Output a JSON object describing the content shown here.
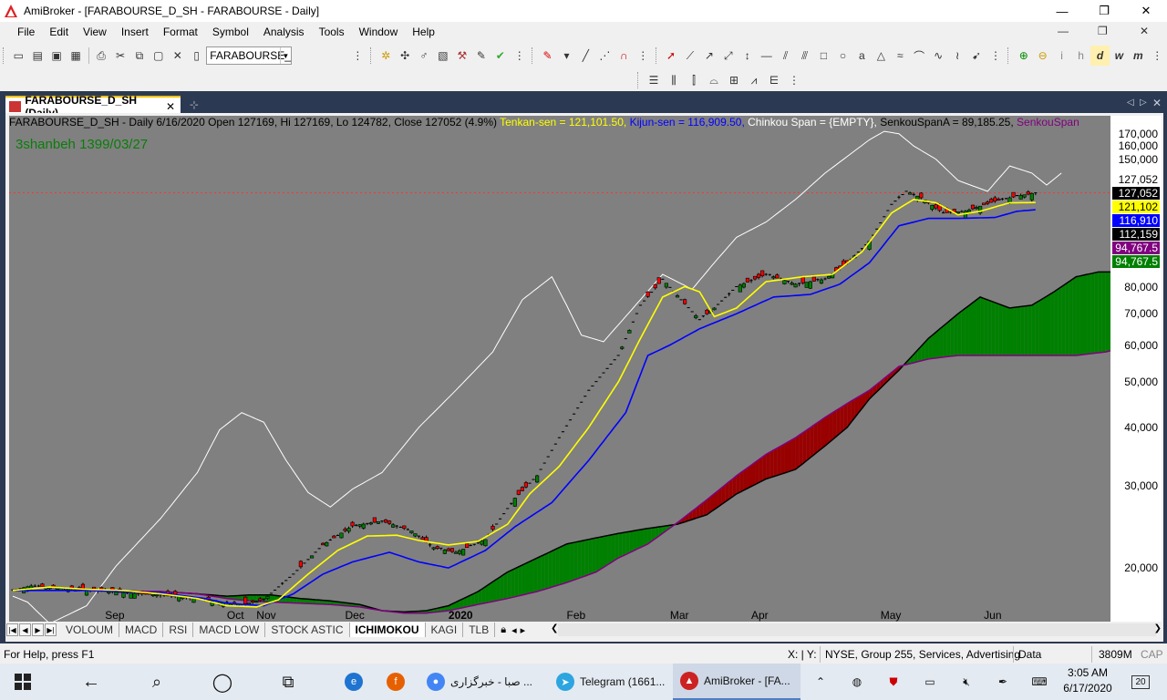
{
  "window": {
    "title": "AmiBroker - [FARABOURSE_D_SH - FARABOURSE - Daily]",
    "minimize": "—",
    "restore": "❐",
    "close": "✕"
  },
  "menu": [
    "File",
    "Edit",
    "View",
    "Insert",
    "Format",
    "Symbol",
    "Analysis",
    "Tools",
    "Window",
    "Help"
  ],
  "mdi": {
    "min": "—",
    "restore": "❐",
    "close": "✕"
  },
  "toolbar": {
    "symbol_value": "FARABOURSE_"
  },
  "doc_tab": {
    "label": "FARABOURSE_D_SH (Daily)",
    "close": "✕"
  },
  "chart_header": {
    "prefix": "FARABOURSE_D_SH - Daily 6/16/2020 Open 127169, Hi 127169, Lo 124782, Close 127052 (4.9%) ",
    "tenkan": "Tenkan-sen = 121,101.50, ",
    "kijun": "Kijun-sen = 116,909.50, ",
    "chinkou": "Chinkou Span = {EMPTY}, ",
    "senkou_a": "SenkouSpanA = 89,185.25, ",
    "senkou_b": "SenkouSpan"
  },
  "date_label": "3shanbeh 1399/03/27",
  "colors": {
    "background": "#808080",
    "tenkan": "#ffff00",
    "kijun": "#0000ff",
    "chinkou": "#ffffff",
    "cloud_bull": "#008000",
    "cloud_bear": "#990000",
    "senkou_a": "#000000",
    "senkou_b": "#800080",
    "candle_up": "#008000",
    "candle_down": "#ff0000"
  },
  "chart_data": {
    "type": "candlestick",
    "y_scale": "log",
    "ylim": [
      16200,
      176000
    ],
    "y_ticks": [
      "170,000",
      "160,000",
      "150,000",
      "80,000",
      "70,000",
      "60,000",
      "50,000",
      "40,000",
      "30,000",
      "20,000"
    ],
    "y_tick_values": [
      170000,
      160000,
      150000,
      80000,
      70000,
      60000,
      50000,
      40000,
      30000,
      20000
    ],
    "x_labels": [
      {
        "label": "Sep",
        "i": 25
      },
      {
        "label": "Oct",
        "i": 58
      },
      {
        "label": "Nov",
        "i": 66
      },
      {
        "label": "Dec",
        "i": 90
      },
      {
        "label": "2020",
        "i": 118
      },
      {
        "label": "Feb",
        "i": 150
      },
      {
        "label": "Mar",
        "i": 178
      },
      {
        "label": "Apr",
        "i": 200
      },
      {
        "label": "May",
        "i": 235
      },
      {
        "label": "Jun",
        "i": 263
      }
    ],
    "n_bars": 278,
    "last_close": 127052,
    "price_badges": [
      {
        "text": "127,052",
        "value": 127052,
        "bg": "#ffffff",
        "fg": "#000000"
      },
      {
        "text": "127,052",
        "value": 127052,
        "bg": "#000000",
        "fg": "#ffffff"
      },
      {
        "text": "121,102",
        "value": 121102,
        "bg": "#ffff00",
        "fg": "#000000"
      },
      {
        "text": "116,910",
        "value": 116910,
        "bg": "#0000ff",
        "fg": "#ffffff"
      },
      {
        "text": "112,159",
        "value": 112159,
        "bg": "#000000",
        "fg": "#ffffff"
      },
      {
        "text": "94,767.5",
        "value": 94767.5,
        "bg": "#800080",
        "fg": "#ffffff"
      },
      {
        "text": "94,767.5",
        "value": 94767.5,
        "bg": "#008000",
        "fg": "#ffffff"
      }
    ],
    "close_anchors": [
      [
        0,
        17900
      ],
      [
        5,
        18300
      ],
      [
        12,
        18100
      ],
      [
        22,
        17900
      ],
      [
        30,
        17700
      ],
      [
        40,
        17500
      ],
      [
        50,
        17200
      ],
      [
        56,
        16900
      ],
      [
        62,
        16700
      ],
      [
        68,
        17100
      ],
      [
        76,
        19400
      ],
      [
        84,
        22400
      ],
      [
        92,
        24600
      ],
      [
        100,
        25200
      ],
      [
        108,
        24000
      ],
      [
        114,
        22100
      ],
      [
        120,
        21600
      ],
      [
        128,
        23000
      ],
      [
        136,
        28200
      ],
      [
        142,
        31500
      ],
      [
        148,
        38000
      ],
      [
        156,
        48000
      ],
      [
        164,
        57000
      ],
      [
        170,
        73000
      ],
      [
        176,
        83000
      ],
      [
        181,
        75000
      ],
      [
        186,
        68000
      ],
      [
        190,
        72000
      ],
      [
        196,
        80000
      ],
      [
        204,
        85000
      ],
      [
        212,
        81000
      ],
      [
        220,
        83000
      ],
      [
        226,
        90000
      ],
      [
        232,
        100000
      ],
      [
        238,
        120000
      ],
      [
        242,
        128000
      ],
      [
        246,
        124000
      ],
      [
        252,
        115000
      ],
      [
        258,
        116000
      ],
      [
        266,
        122000
      ],
      [
        272,
        125000
      ],
      [
        277,
        127052
      ]
    ],
    "tenkan_anchors": [
      [
        0,
        17900
      ],
      [
        10,
        18200
      ],
      [
        20,
        18000
      ],
      [
        30,
        17900
      ],
      [
        40,
        17600
      ],
      [
        50,
        17200
      ],
      [
        54,
        16900
      ],
      [
        58,
        16600
      ],
      [
        66,
        16500
      ],
      [
        72,
        17100
      ],
      [
        80,
        19400
      ],
      [
        88,
        21800
      ],
      [
        96,
        23400
      ],
      [
        104,
        23500
      ],
      [
        110,
        22900
      ],
      [
        118,
        22400
      ],
      [
        126,
        22800
      ],
      [
        134,
        24800
      ],
      [
        140,
        28800
      ],
      [
        148,
        33000
      ],
      [
        156,
        40000
      ],
      [
        164,
        50000
      ],
      [
        170,
        62000
      ],
      [
        176,
        76000
      ],
      [
        182,
        80000
      ],
      [
        186,
        78000
      ],
      [
        190,
        69000
      ],
      [
        196,
        72000
      ],
      [
        204,
        82000
      ],
      [
        214,
        84000
      ],
      [
        222,
        85000
      ],
      [
        230,
        95000
      ],
      [
        238,
        115000
      ],
      [
        244,
        123000
      ],
      [
        250,
        121000
      ],
      [
        256,
        114000
      ],
      [
        262,
        116000
      ],
      [
        270,
        121000
      ],
      [
        277,
        121102
      ]
    ],
    "kijun_anchors": [
      [
        0,
        17900
      ],
      [
        20,
        17900
      ],
      [
        40,
        17700
      ],
      [
        52,
        17200
      ],
      [
        58,
        16800
      ],
      [
        68,
        16600
      ],
      [
        76,
        17600
      ],
      [
        84,
        19400
      ],
      [
        92,
        20600
      ],
      [
        102,
        21600
      ],
      [
        110,
        20600
      ],
      [
        118,
        20000
      ],
      [
        128,
        21800
      ],
      [
        136,
        24500
      ],
      [
        146,
        27600
      ],
      [
        156,
        34000
      ],
      [
        166,
        43000
      ],
      [
        172,
        57000
      ],
      [
        178,
        60000
      ],
      [
        186,
        65000
      ],
      [
        196,
        70000
      ],
      [
        206,
        76000
      ],
      [
        216,
        77000
      ],
      [
        224,
        81000
      ],
      [
        232,
        90000
      ],
      [
        240,
        108000
      ],
      [
        248,
        112000
      ],
      [
        256,
        112000
      ],
      [
        266,
        112500
      ],
      [
        272,
        116000
      ],
      [
        277,
        116910
      ]
    ],
    "chinkou_anchors": [
      [
        0,
        17400
      ],
      [
        4,
        16900
      ],
      [
        10,
        15200
      ],
      [
        20,
        16600
      ],
      [
        28,
        20200
      ],
      [
        40,
        25500
      ],
      [
        50,
        32000
      ],
      [
        56,
        39500
      ],
      [
        62,
        43000
      ],
      [
        68,
        41000
      ],
      [
        74,
        34000
      ],
      [
        80,
        29000
      ],
      [
        86,
        27000
      ],
      [
        92,
        29500
      ],
      [
        100,
        32000
      ],
      [
        110,
        40000
      ],
      [
        120,
        48000
      ],
      [
        130,
        58000
      ],
      [
        138,
        75000
      ],
      [
        146,
        84000
      ],
      [
        150,
        73000
      ],
      [
        154,
        63000
      ],
      [
        160,
        61000
      ],
      [
        168,
        72000
      ],
      [
        176,
        85000
      ],
      [
        184,
        79000
      ],
      [
        190,
        90000
      ],
      [
        196,
        102000
      ],
      [
        204,
        110000
      ],
      [
        212,
        123000
      ],
      [
        220,
        140000
      ],
      [
        226,
        152000
      ],
      [
        232,
        165000
      ],
      [
        236,
        172000
      ],
      [
        240,
        170000
      ],
      [
        244,
        160000
      ],
      [
        250,
        150000
      ],
      [
        256,
        135000
      ],
      [
        264,
        128000
      ],
      [
        270,
        145000
      ],
      [
        276,
        140000
      ],
      [
        280,
        132000
      ],
      [
        284,
        140000
      ]
    ],
    "senkou_a_anchors": [
      [
        0,
        17900
      ],
      [
        20,
        17900
      ],
      [
        40,
        17800
      ],
      [
        50,
        17600
      ],
      [
        58,
        17400
      ],
      [
        64,
        17500
      ],
      [
        70,
        17500
      ],
      [
        78,
        17200
      ],
      [
        86,
        17000
      ],
      [
        94,
        16700
      ],
      [
        100,
        16200
      ],
      [
        106,
        16100
      ],
      [
        112,
        16200
      ],
      [
        118,
        16600
      ],
      [
        126,
        17800
      ],
      [
        134,
        19600
      ],
      [
        142,
        21000
      ],
      [
        150,
        22500
      ],
      [
        158,
        23200
      ],
      [
        164,
        23700
      ],
      [
        172,
        24300
      ],
      [
        180,
        24800
      ],
      [
        188,
        26000
      ],
      [
        196,
        28800
      ],
      [
        204,
        31000
      ],
      [
        212,
        32500
      ],
      [
        220,
        36500
      ],
      [
        226,
        40000
      ],
      [
        232,
        46000
      ],
      [
        240,
        53000
      ],
      [
        248,
        62000
      ],
      [
        256,
        70000
      ],
      [
        262,
        76000
      ],
      [
        270,
        72000
      ],
      [
        276,
        73000
      ],
      [
        282,
        78000
      ],
      [
        288,
        84000
      ],
      [
        294,
        86000
      ],
      [
        300,
        86000
      ],
      [
        306,
        87000
      ],
      [
        314,
        90000
      ],
      [
        320,
        95000
      ],
      [
        330,
        105000
      ],
      [
        340,
        107000
      ],
      [
        346,
        106000
      ]
    ],
    "senkou_b_anchors": [
      [
        0,
        17900
      ],
      [
        20,
        17900
      ],
      [
        40,
        17800
      ],
      [
        50,
        17600
      ],
      [
        58,
        17200
      ],
      [
        64,
        17000
      ],
      [
        70,
        16900
      ],
      [
        78,
        16800
      ],
      [
        86,
        16700
      ],
      [
        94,
        16500
      ],
      [
        100,
        16200
      ],
      [
        106,
        16000
      ],
      [
        112,
        16000
      ],
      [
        118,
        16200
      ],
      [
        126,
        16700
      ],
      [
        134,
        17200
      ],
      [
        142,
        17800
      ],
      [
        150,
        18600
      ],
      [
        158,
        19600
      ],
      [
        164,
        21000
      ],
      [
        172,
        22500
      ],
      [
        180,
        25000
      ],
      [
        188,
        28000
      ],
      [
        196,
        31500
      ],
      [
        204,
        35000
      ],
      [
        212,
        38000
      ],
      [
        220,
        42000
      ],
      [
        226,
        45000
      ],
      [
        232,
        48000
      ],
      [
        240,
        54000
      ],
      [
        248,
        56000
      ],
      [
        256,
        57000
      ],
      [
        264,
        57000
      ],
      [
        272,
        57000
      ],
      [
        280,
        57000
      ],
      [
        288,
        57000
      ],
      [
        296,
        58000
      ],
      [
        304,
        60000
      ],
      [
        312,
        62000
      ],
      [
        320,
        66000
      ],
      [
        330,
        80000
      ],
      [
        340,
        88000
      ],
      [
        346,
        89000
      ]
    ]
  },
  "sheet_tabs": [
    "VOLOUM",
    "MACD",
    "RSI",
    "MACD LOW",
    "STOCK ASTIC",
    "ICHIMOKOU",
    "KAGI",
    "TLB"
  ],
  "sheet_active": "ICHIMOKOU",
  "status": {
    "help": "For Help, press F1",
    "coords": "X:  | Y:",
    "info": "NYSE, Group 255, Services, Advertising",
    "data": "Data",
    "mem": "3809M",
    "cap": "CAP"
  },
  "taskbar": {
    "apps": [
      {
        "label": "صبا - خبرگزاری ...",
        "color": "#4285f4"
      },
      {
        "label": "Telegram (1661...",
        "color": "#2ca5e0"
      },
      {
        "label": "AmiBroker - [FA...",
        "color": "#cc2222"
      }
    ],
    "time": "3:05 AM",
    "date": "6/17/2020",
    "notif": "20"
  }
}
